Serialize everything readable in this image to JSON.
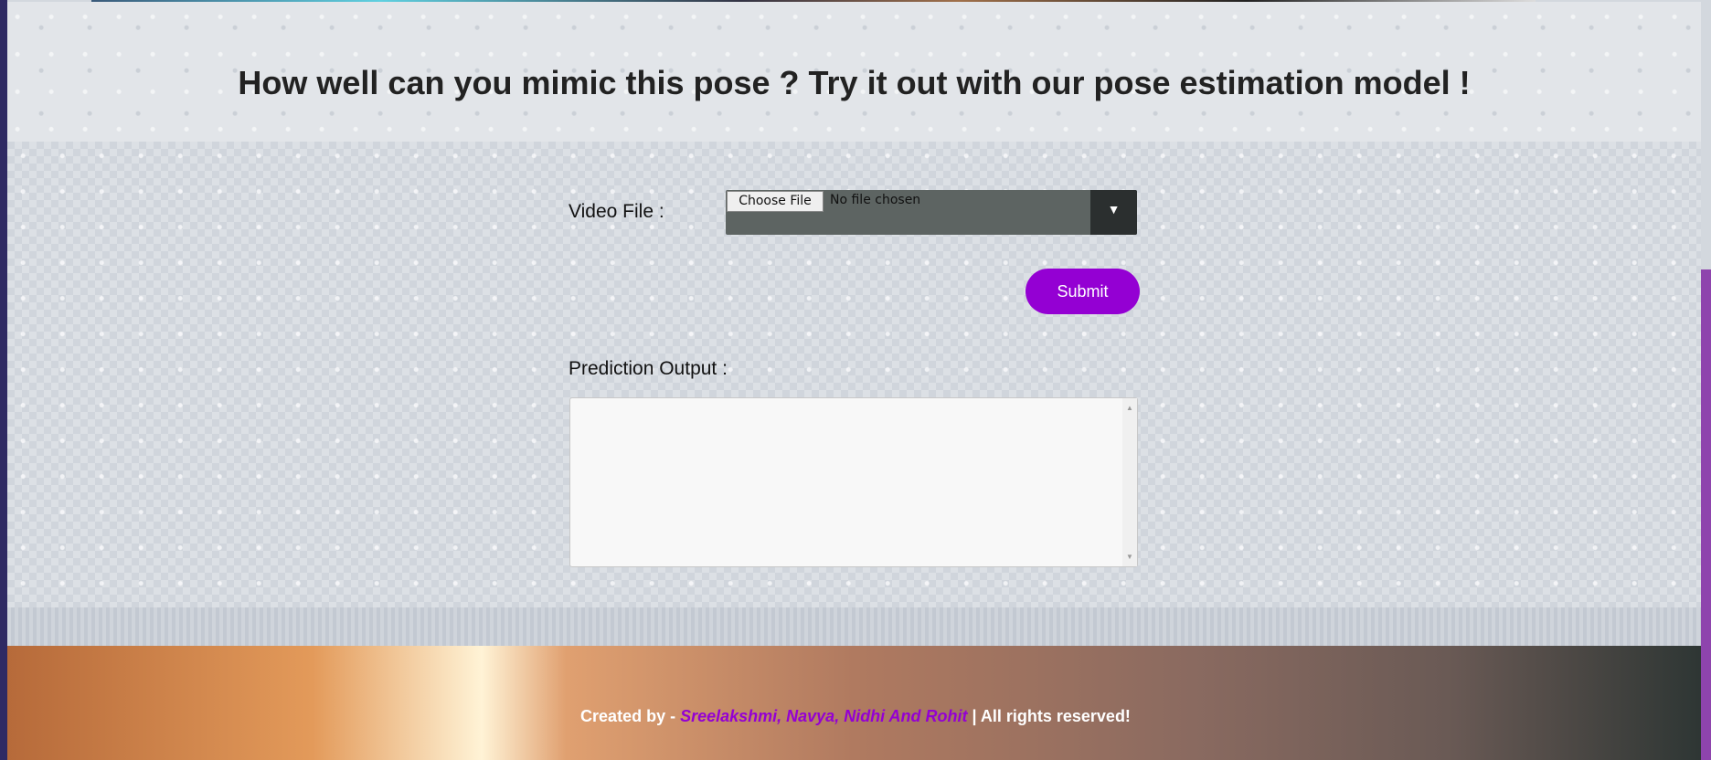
{
  "header": {
    "title": "How well can you mimic this pose ? Try it out with our pose estimation model !"
  },
  "form": {
    "video_label": "Video File :",
    "choose_file": "Choose File",
    "no_file": "No file chosen",
    "dropdown_icon": "▼",
    "submit": "Submit",
    "output_label": "Prediction Output :",
    "output_value": ""
  },
  "footer": {
    "prefix": "Created by - ",
    "names": "Sreelakshmi, Navya, Nidhi And Rohit",
    "suffix": " | All rights reserved!"
  },
  "colors": {
    "accent": "#9400d3",
    "sidebar": "#8e44ad"
  }
}
